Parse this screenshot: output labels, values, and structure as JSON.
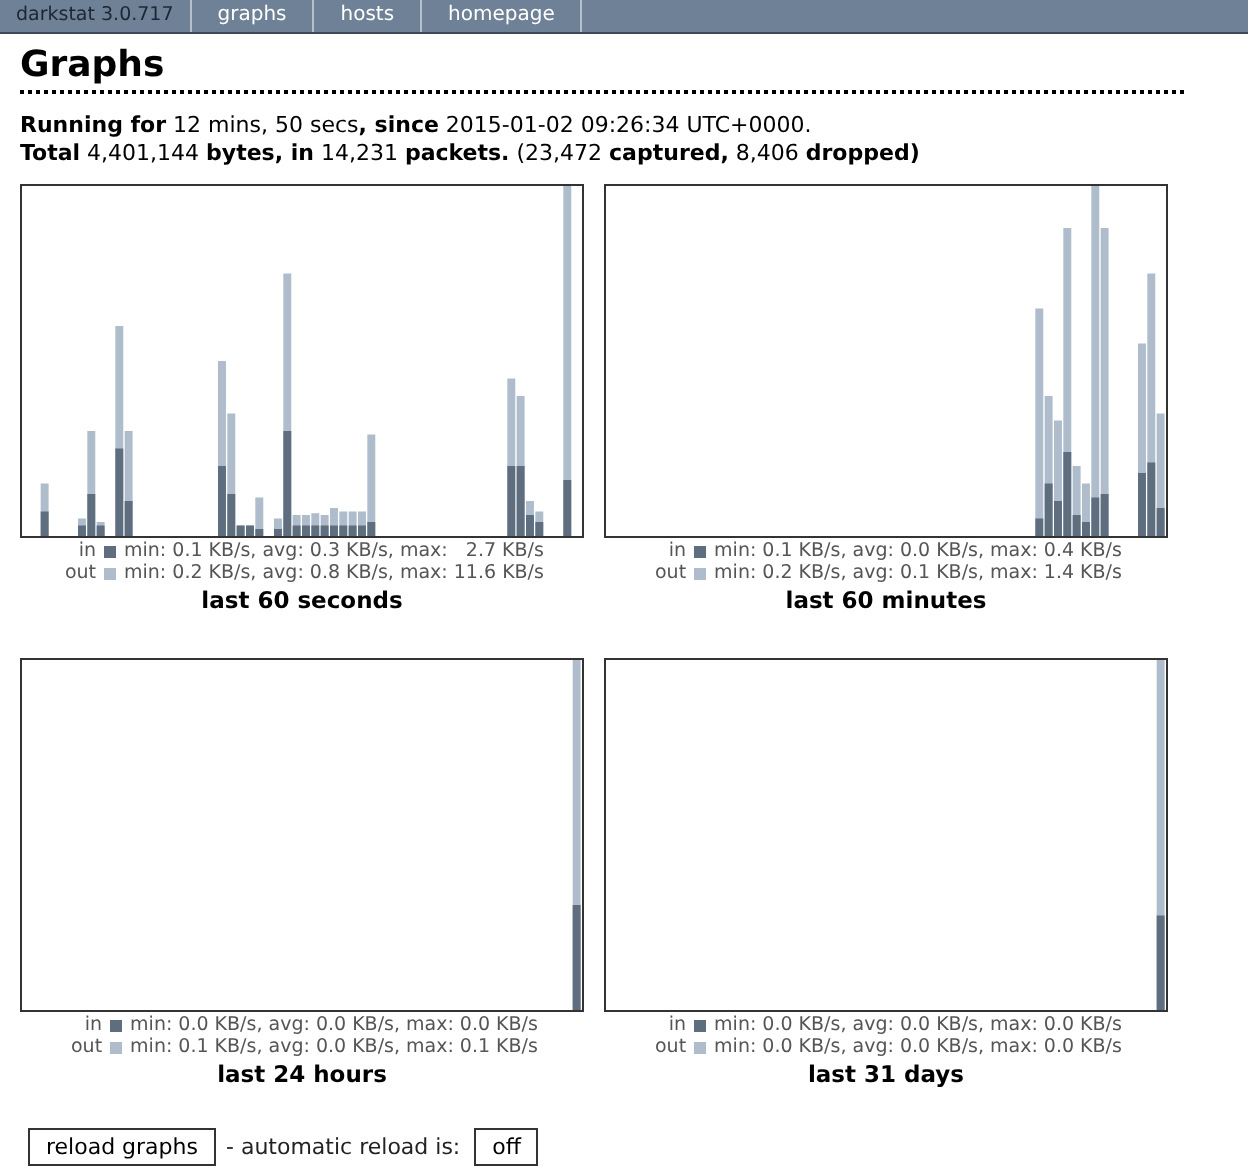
{
  "nav": [
    {
      "label": "darkstat 3.0.717",
      "kind": "brand"
    },
    {
      "label": "graphs",
      "kind": "link"
    },
    {
      "label": "hosts",
      "kind": "link"
    },
    {
      "label": "homepage",
      "kind": "link"
    }
  ],
  "title": "Graphs",
  "summary": [
    "**Running for** 12 mins, 50 secs**, since** 2015-01-02 09:26:34 UTC+0000.",
    "**Total** 4,401,144 **bytes, in** 14,231 **packets.** (23,472 **captured,** 8,406 **dropped)**"
  ],
  "graphs": [
    {
      "title": "last 60 seconds",
      "legend": [
        {
          "kind": "in",
          "label": "in",
          "text": "min: 0.1 KB/s, avg: 0.3 KB/s, max:   2.7 KB/s"
        },
        {
          "kind": "out",
          "label": "out",
          "text": "min: 0.2 KB/s, avg: 0.8 KB/s, max: 11.6 KB/s"
        }
      ]
    },
    {
      "title": "last 60 minutes",
      "legend": [
        {
          "kind": "in",
          "label": "in",
          "text": "min: 0.1 KB/s, avg: 0.0 KB/s, max: 0.4 KB/s"
        },
        {
          "kind": "out",
          "label": "out",
          "text": "min: 0.2 KB/s, avg: 0.1 KB/s, max: 1.4 KB/s"
        }
      ]
    },
    {
      "title": "last 24 hours",
      "legend": [
        {
          "kind": "in",
          "label": "in",
          "text": "min: 0.0 KB/s, avg: 0.0 KB/s, max: 0.0 KB/s"
        },
        {
          "kind": "out",
          "label": "out",
          "text": "min: 0.1 KB/s, avg: 0.0 KB/s, max: 0.1 KB/s"
        }
      ]
    },
    {
      "title": "last 31 days",
      "legend": [
        {
          "kind": "in",
          "label": "in",
          "text": "min: 0.0 KB/s, avg: 0.0 KB/s, max: 0.0 KB/s"
        },
        {
          "kind": "out",
          "label": "out",
          "text": "min: 0.0 KB/s, avg: 0.0 KB/s, max: 0.0 KB/s"
        }
      ]
    }
  ],
  "footer": {
    "reload_button": "reload graphs",
    "label": "- automatic reload is:",
    "auto_button": "off"
  }
}
